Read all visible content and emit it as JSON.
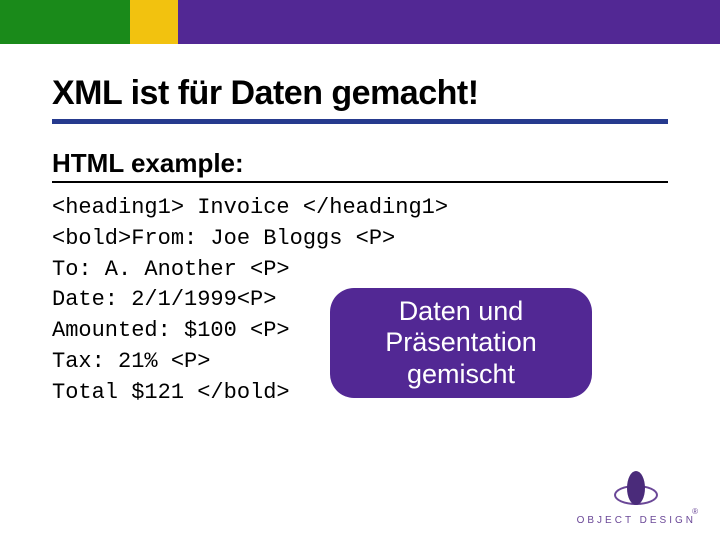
{
  "header": {
    "title": "XML ist für Daten gemacht!",
    "subtitle": "HTML example:"
  },
  "code": {
    "line1": "<heading1> Invoice </heading1>",
    "line2": "<bold>From: Joe Bloggs <P>",
    "line3": "To: A. Another <P>",
    "line4": "Date: 2/1/1999<P>",
    "line5": "Amounted: $100 <P>",
    "line6": "Tax: 21% <P>",
    "line7": "Total $121 </bold>"
  },
  "callout": {
    "text": "Daten und Präsentation gemischt"
  },
  "logo": {
    "text": "OBJECT DESIGN"
  }
}
